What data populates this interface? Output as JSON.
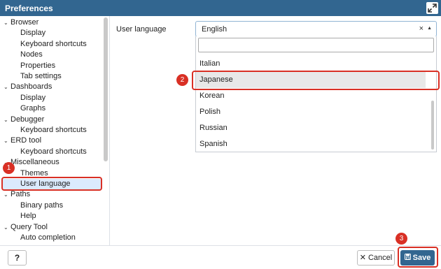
{
  "window": {
    "title": "Preferences",
    "maximize_icon": "expand-icon"
  },
  "sidebar": {
    "items": [
      {
        "label": "Browser",
        "level": 0,
        "expanded": true
      },
      {
        "label": "Display",
        "level": 1
      },
      {
        "label": "Keyboard shortcuts",
        "level": 1
      },
      {
        "label": "Nodes",
        "level": 1
      },
      {
        "label": "Properties",
        "level": 1
      },
      {
        "label": "Tab settings",
        "level": 1
      },
      {
        "label": "Dashboards",
        "level": 0,
        "expanded": true
      },
      {
        "label": "Display",
        "level": 1
      },
      {
        "label": "Graphs",
        "level": 1
      },
      {
        "label": "Debugger",
        "level": 0,
        "expanded": true
      },
      {
        "label": "Keyboard shortcuts",
        "level": 1
      },
      {
        "label": "ERD tool",
        "level": 0,
        "expanded": true
      },
      {
        "label": "Keyboard shortcuts",
        "level": 1
      },
      {
        "label": "Miscellaneous",
        "level": 0,
        "expanded": true
      },
      {
        "label": "Themes",
        "level": 1
      },
      {
        "label": "User language",
        "level": 1,
        "selected": true
      },
      {
        "label": "Paths",
        "level": 0,
        "expanded": true
      },
      {
        "label": "Binary paths",
        "level": 1
      },
      {
        "label": "Help",
        "level": 1
      },
      {
        "label": "Query Tool",
        "level": 0,
        "expanded": true
      },
      {
        "label": "Auto completion",
        "level": 1
      }
    ]
  },
  "main": {
    "user_language_label": "User language",
    "select_value": "English",
    "clear_glyph": "×",
    "arrow_glyph": "▲",
    "options": [
      "Italian",
      "Japanese",
      "Korean",
      "Polish",
      "Russian",
      "Spanish"
    ],
    "hovered_option": "Japanese"
  },
  "annotations": {
    "marker_1": "1",
    "marker_2": "2",
    "marker_3": "3"
  },
  "footer": {
    "help_label": "?",
    "cancel_label": "Cancel",
    "cancel_glyph": "✕",
    "save_label": "Save",
    "save_glyph": "💾"
  },
  "colors": {
    "titlebar": "#326690",
    "accent": "#326690",
    "highlight": "#d93025",
    "selected_row": "#dbeafd"
  }
}
